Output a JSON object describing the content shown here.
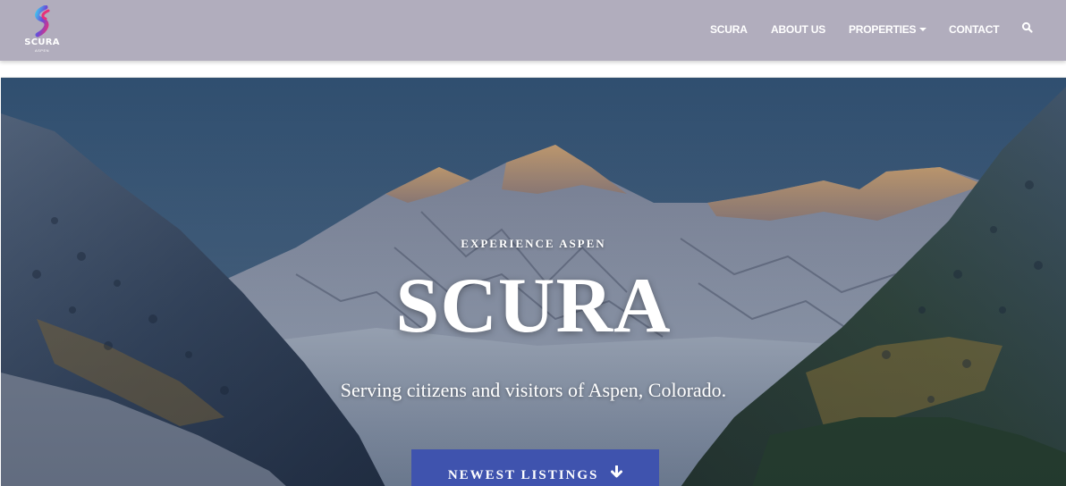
{
  "brand": {
    "logo_text": "SCURA",
    "logo_subtext": "ASPEN"
  },
  "nav": {
    "items": [
      {
        "label": "SCURA"
      },
      {
        "label": "ABOUT US"
      },
      {
        "label": "PROPERTIES",
        "has_dropdown": true
      },
      {
        "label": "CONTACT"
      }
    ],
    "search_icon": "search-icon"
  },
  "hero": {
    "eyebrow": "EXPERIENCE ASPEN",
    "title": "SCURA",
    "subtitle": "Serving citizens and visitors of Aspen, Colorado.",
    "cta_label": "NEWEST LISTINGS",
    "cta_icon": "arrow-down-icon"
  },
  "colors": {
    "navbar_bg": "#b1adbd",
    "cta_bg": "#3f53ae",
    "text": "#ffffff"
  }
}
